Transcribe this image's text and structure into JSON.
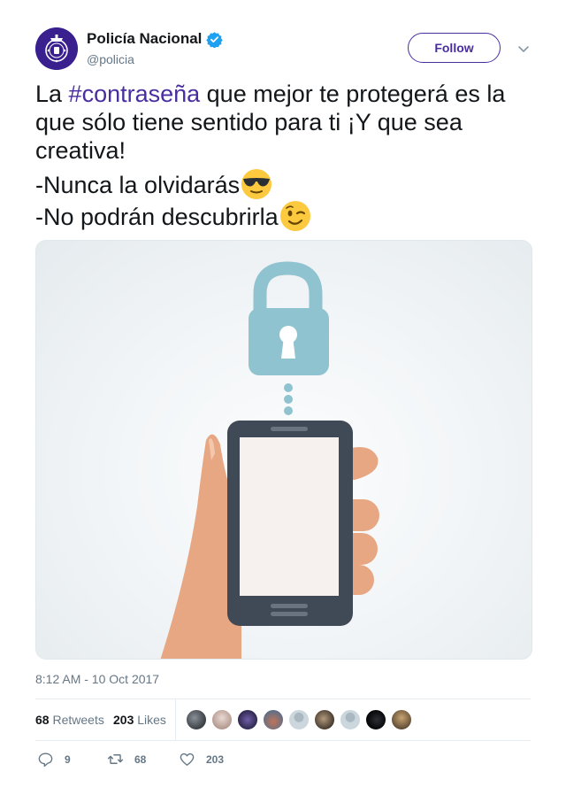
{
  "tweet": {
    "author": {
      "display_name": "Policía Nacional",
      "handle": "@policia",
      "verified": true,
      "avatar_color": "#3a1f8f"
    },
    "follow_label": "Follow",
    "text": {
      "line1_prefix": "La ",
      "hashtag": "#contraseña",
      "line1_rest": " que mejor te protegerá es la que sólo tiene sentido para ti ¡Y que sea creativa!",
      "line2": "-Nunca la olvidarás",
      "line2_emoji": "smiling-face-with-sunglasses",
      "line3": "-No podrán descubrirla",
      "line3_emoji": "winking-face"
    },
    "media": {
      "description_icons": [
        "unlocked-padlock-icon",
        "smartphone-icon",
        "hand-icon"
      ]
    },
    "timestamp": "8:12 AM - 10 Oct 2017",
    "stats": {
      "retweets_count": "68",
      "retweets_label": "Retweets",
      "likes_count": "203",
      "likes_label": "Likes",
      "liker_avatars": 9
    },
    "actions": {
      "reply_count": "9",
      "retweet_count": "68",
      "like_count": "203"
    },
    "colors": {
      "accent": "#4a2ea0",
      "verified": "#1da1f2",
      "muted": "#657786",
      "lock": "#8fc3cf",
      "phone": "#404a57",
      "hand": "#e8a783"
    }
  }
}
